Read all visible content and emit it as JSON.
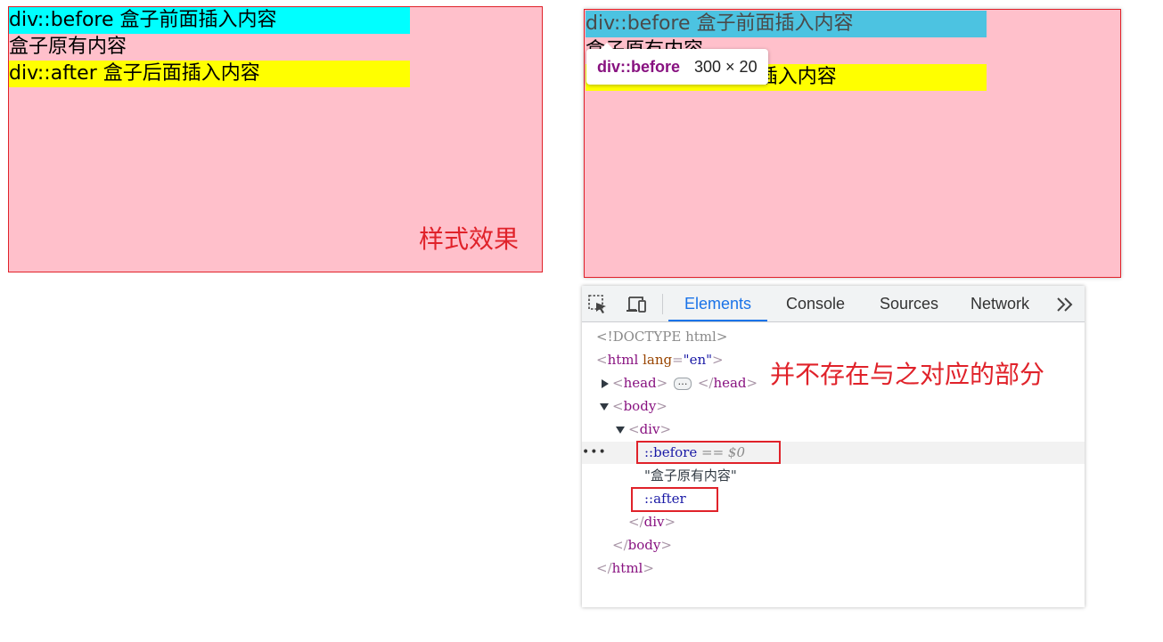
{
  "colors": {
    "pink_box": "#ffc0cb",
    "before_bg": "#00ffff",
    "after_bg": "#ffff00",
    "annotation_red": "#e0222a",
    "devtools_accent": "#1a73e8"
  },
  "demo_left": {
    "before_text": "div::before 盒子前面插入内容",
    "content_text": "盒子原有内容",
    "after_text": "div::after 盒子后面插入内容",
    "style_effect_label": "样式效果"
  },
  "demo_right": {
    "before_text": "div::before 盒子前面插入内容",
    "content_text": "盒子原有内容",
    "after_text": "div::after 盒子后面插入内容",
    "tooltip": {
      "selector": "div::before",
      "size": "300 × 20"
    }
  },
  "devtools": {
    "toolbar": {
      "inspect_icon": "inspect-element-icon",
      "device_icon": "device-toolbar-icon",
      "more_icon": "more-tabs-icon"
    },
    "tabs": [
      {
        "label": "Elements",
        "active": true
      },
      {
        "label": "Console",
        "active": false
      },
      {
        "label": "Sources",
        "active": false
      },
      {
        "label": "Network",
        "active": false
      }
    ],
    "dom": {
      "doctype": "<!DOCTYPE html>",
      "html_open_tag": "html",
      "html_attr_name": "lang",
      "html_attr_value": "\"en\"",
      "head_tag": "head",
      "head_collapsed": "…",
      "body_tag": "body",
      "div_tag": "div",
      "before_pseudo": "::before",
      "selected_marker": "== $0",
      "text_node": "\"盒子原有内容\"",
      "after_pseudo": "::after",
      "row_menu": "•••"
    },
    "annotation": "并不存在与之对应的部分"
  }
}
